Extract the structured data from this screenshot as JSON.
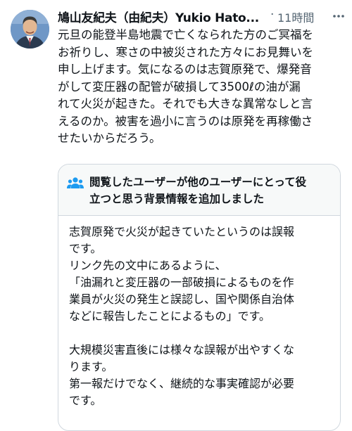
{
  "tweet": {
    "author": "鳩山友紀夫（由紀夫）Yukio Hato...",
    "separator": "·",
    "time": "11時間",
    "text_lines": [
      "元旦の能登半島地震で亡くなられた方のご冥福を",
      "お祈りし、寒さの中被災された方々にお見舞いを",
      "申し上げます。気になるのは志賀原発で、爆発音",
      "がして変圧器の配管が破損して3500ℓの油が漏",
      "れて火災が起きた。それでも大きな異常なしと言",
      "えるのか。被害を過小に言うのは原発を再稼働さ",
      "せたいからだろう。"
    ]
  },
  "note": {
    "title_lines": [
      "閲覧したユーザーが他のユーザーにとって役",
      "立つと思う背景情報を追加しました"
    ],
    "body_lines": [
      "志賀原発で火災が起きていたというのは誤報",
      "です。",
      "リンク先の文中にあるように、",
      "「油漏れと変圧器の一部破損によるものを作",
      "業員が火災の発生と誤認し、国や関係自治体",
      "などに報告したことによるもの」です。",
      "",
      "大規模災害直後には様々な誤報が出やすくな",
      "ります。",
      "第一報だけでなく、継続的な事実確認が必要",
      "です。"
    ]
  },
  "icons": {
    "avatar": "avatar",
    "more": "more-icon",
    "community": "people-icon"
  },
  "colors": {
    "text": "#0f1419",
    "secondary": "#536471",
    "note_header_bg": "#f7f9f9",
    "community_icon": "#1d9bf0"
  }
}
